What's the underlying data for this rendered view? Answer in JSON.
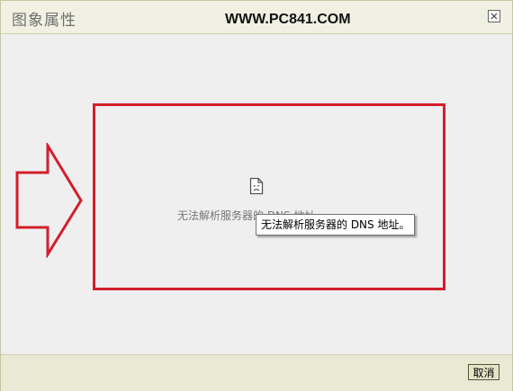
{
  "window": {
    "title": "图象属性",
    "watermark": "WWW.PC841.COM"
  },
  "content": {
    "error_message": "无法解析服务器的 DNS 地址。",
    "tooltip": "无法解析服务器的 DNS 地址。",
    "broken_image_icon": "sad-document-icon"
  },
  "annotation": {
    "arrow_icon": "right-arrow-icon",
    "color": "#d21f2b"
  },
  "footer": {
    "cancel_label": "取消"
  },
  "icons": {
    "close": "close-icon"
  }
}
